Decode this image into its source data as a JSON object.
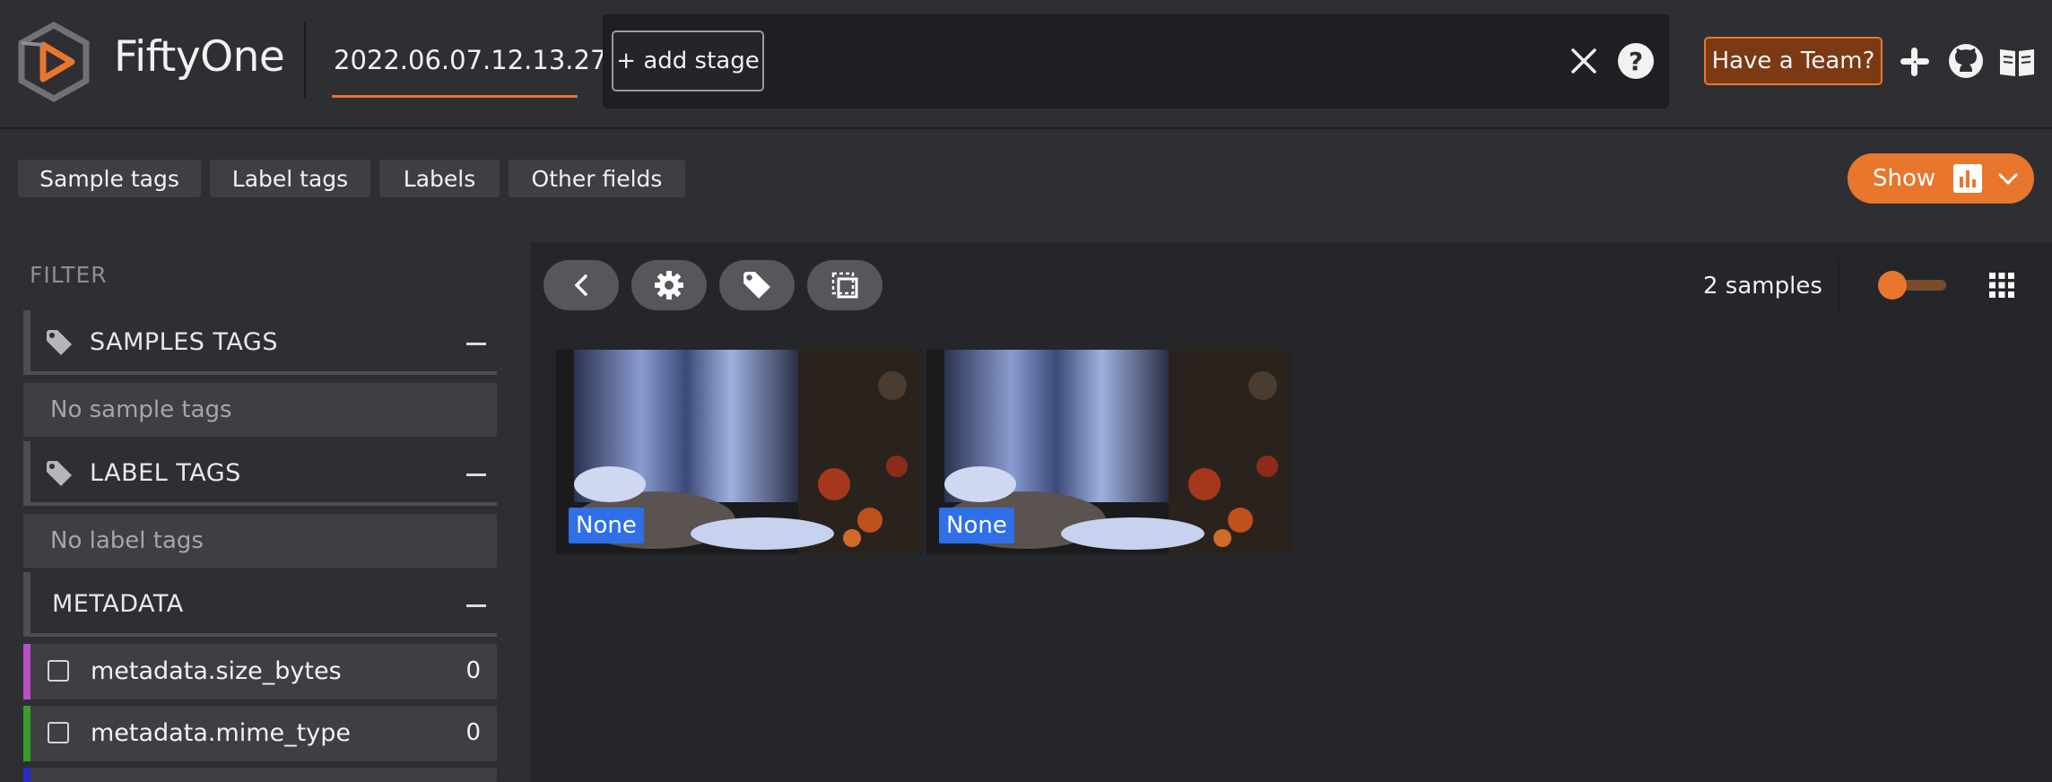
{
  "header": {
    "brand": "FiftyOne",
    "dataset_name": "2022.06.07.12.13.27",
    "add_stage_label": "+ add stage",
    "team_button_label": "Have a Team?"
  },
  "groups": {
    "items": [
      "Sample tags",
      "Label tags",
      "Labels",
      "Other fields"
    ],
    "show_label": "Show"
  },
  "sidebar": {
    "filter_label": "FILTER",
    "sections": {
      "samples_tags": "SAMPLES TAGS",
      "samples_tags_empty": "No sample tags",
      "label_tags": "LABEL TAGS",
      "label_tags_empty": "No label tags",
      "metadata": "METADATA"
    },
    "fields": [
      {
        "name": "metadata.size_bytes",
        "count": "0",
        "color": "#b94fc6"
      },
      {
        "name": "metadata.mime_type",
        "count": "0",
        "color": "#3a9a2a"
      }
    ]
  },
  "grid": {
    "count_label": "2 samples",
    "thumbnails": [
      {
        "badge": "None"
      },
      {
        "badge": "None"
      }
    ]
  },
  "colors": {
    "accent": "#e8762d",
    "badge": "#2f6fe8",
    "background": "#252629",
    "panel": "#2d2f33"
  }
}
